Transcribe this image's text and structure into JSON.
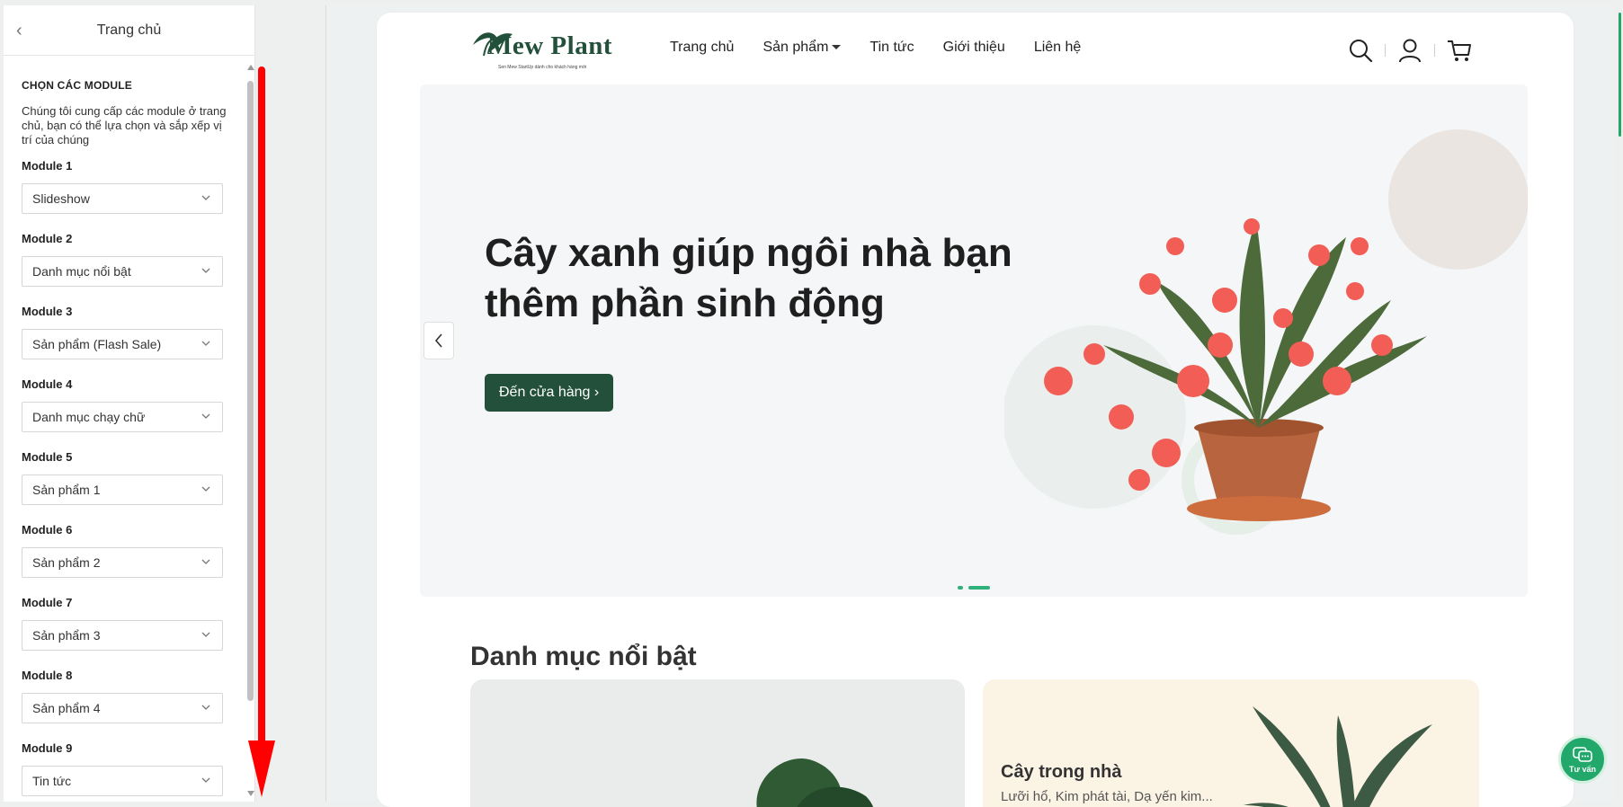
{
  "panel": {
    "title": "Trang chủ",
    "section_title": "CHỌN CÁC MODULE",
    "section_desc": "Chúng tôi cung cấp các module ở trang chủ, bạn có thể lựa chọn và sắp xếp vị trí của chúng",
    "modules": [
      {
        "label": "Module 1",
        "value": "Slideshow"
      },
      {
        "label": "Module 2",
        "value": "Danh mục nổi bật"
      },
      {
        "label": "Module 3",
        "value": "Sản phẩm (Flash Sale)"
      },
      {
        "label": "Module 4",
        "value": "Danh mục chạy chữ"
      },
      {
        "label": "Module 5",
        "value": "Sản phẩm 1"
      },
      {
        "label": "Module 6",
        "value": "Sản phẩm 2"
      },
      {
        "label": "Module 7",
        "value": "Sản phẩm 3"
      },
      {
        "label": "Module 8",
        "value": "Sản phẩm 4"
      },
      {
        "label": "Module 9",
        "value": "Tin tức"
      }
    ]
  },
  "site": {
    "logo_text": "Mew Plant",
    "logo_tagline": "Sen Mew StartUp dành cho khách hàng mới",
    "nav": [
      "Trang chủ",
      "Sản phẩm",
      "Tin tức",
      "Giới thiệu",
      "Liên hệ"
    ],
    "header_icons": [
      "search-icon",
      "user-icon",
      "cart-icon"
    ],
    "banner": {
      "heading": "Cây xanh giúp ngôi nhà bạn thêm phần sinh động",
      "button": "Đến cửa hàng ›",
      "slides": 2,
      "active_slide": 2
    },
    "featured_title": "Danh mục nổi bật",
    "cards": [
      {
        "title": "",
        "desc": ""
      },
      {
        "title": "Cây trong nhà",
        "desc": "Lưỡi hổ, Kim phát tài, Dạ yến kim..."
      }
    ]
  },
  "chat": {
    "label": "Tư vấn"
  },
  "colors": {
    "brand": "#23503a",
    "accent": "#23a86b",
    "annotation": "#ff0000"
  }
}
